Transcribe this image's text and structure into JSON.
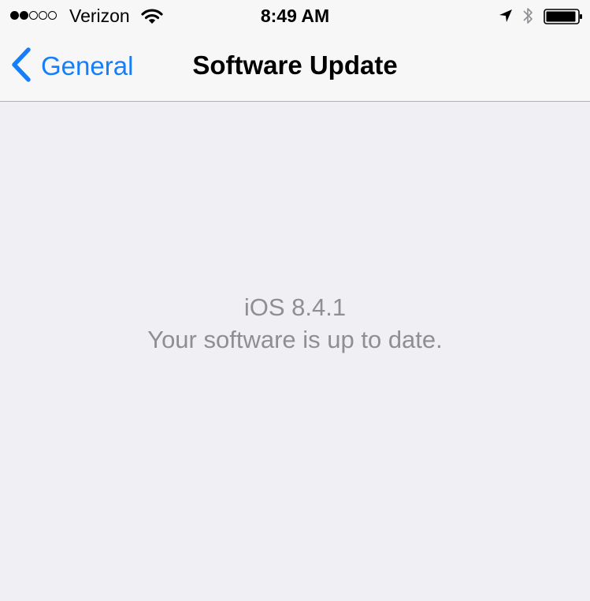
{
  "status_bar": {
    "signal_strength": 2,
    "signal_max": 5,
    "carrier": "Verizon",
    "time": "8:49 AM",
    "icons": [
      "wifi-icon",
      "location-arrow-icon",
      "bluetooth-icon",
      "battery-icon"
    ],
    "battery_level": 0.95
  },
  "nav": {
    "back_label": "General",
    "title": "Software Update"
  },
  "content": {
    "version": "iOS 8.4.1",
    "message": "Your software is up to date."
  },
  "colors": {
    "accent": "#157efb",
    "background": "#efeff4",
    "header_background": "#f7f7f7",
    "secondary_text": "#8e8e93"
  }
}
